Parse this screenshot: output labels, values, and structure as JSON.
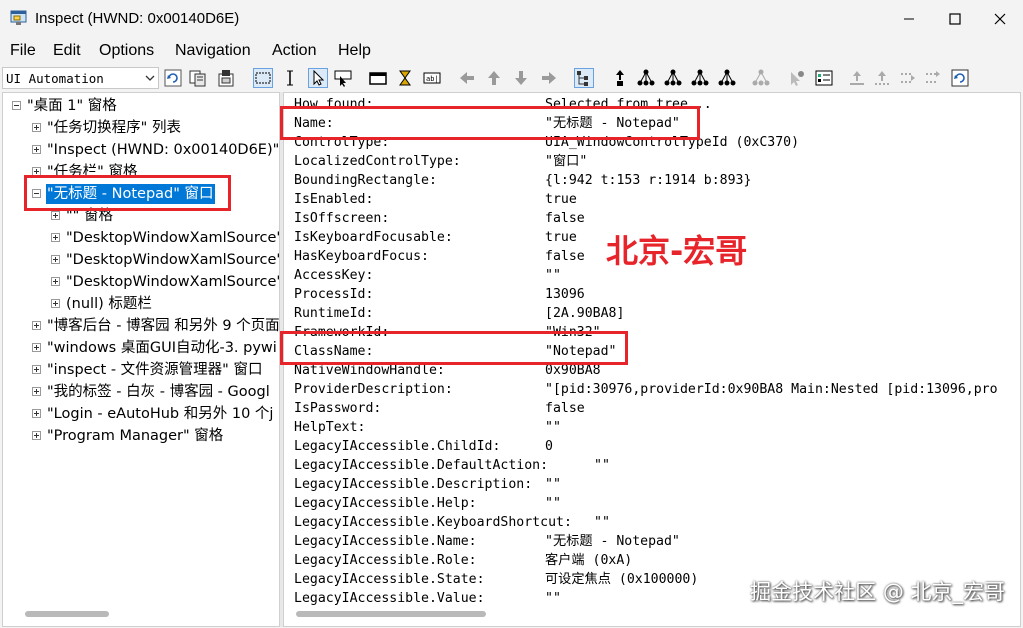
{
  "window": {
    "title": "Inspect  (HWND: 0x00140D6E)",
    "minimize_glyph": "—",
    "maximize_glyph": "☐",
    "close_glyph": "✕"
  },
  "menu": [
    "File",
    "Edit",
    "Options",
    "Navigation",
    "Action",
    "Help"
  ],
  "toolbar": {
    "mode_value": "UI Automation",
    "icons": [
      "refresh-icon",
      "copy-icon",
      "export-icon",
      "highlight-rect-icon",
      "text-cursor-icon",
      "pointer-icon",
      "watch-cursor-icon",
      "focus-icon",
      "hover-icon",
      "caret-icon",
      "nav-left-icon",
      "nav-up-icon",
      "nav-down-icon",
      "nav-right-icon",
      "tree-view-icon",
      "parent-icon",
      "first-child-icon",
      "next-sibling-icon",
      "prev-sibling-icon",
      "last-child-icon",
      "ancestor-icon",
      "do-default-icon",
      "options-icon",
      "move-icon",
      "expand-icon",
      "settings-icon"
    ]
  },
  "tree": [
    {
      "label": "\"桌面 1\" 窗格",
      "expander": "minus"
    },
    {
      "label": "\"任务切换程序\" 列表",
      "expander": "plus"
    },
    {
      "label": "\"Inspect  (HWND: 0x00140D6E)\"",
      "expander": "plus"
    },
    {
      "label": "\"任务栏\" 窗格",
      "expander": "plus"
    },
    {
      "label": "\"无标题 - Notepad\" 窗口",
      "expander": "minus",
      "selected": true
    },
    {
      "label": "\"\" 窗格",
      "expander": "plus"
    },
    {
      "label": "\"DesktopWindowXamlSource\"",
      "expander": "plus"
    },
    {
      "label": "\"DesktopWindowXamlSource\"",
      "expander": "plus"
    },
    {
      "label": "\"DesktopWindowXamlSource\"",
      "expander": "plus"
    },
    {
      "label": "(null) 标题栏",
      "expander": "plus"
    },
    {
      "label": "\"博客后台 - 博客园 和另外 9 个页面",
      "expander": "plus"
    },
    {
      "label": "\"windows 桌面GUI自动化-3. pywi",
      "expander": "plus"
    },
    {
      "label": "\"inspect - 文件资源管理器\" 窗口",
      "expander": "plus"
    },
    {
      "label": "\"我的标签 - 白灰 - 博客园 - Googl",
      "expander": "plus"
    },
    {
      "label": "\"Login - eAutoHub 和另外 10 个j",
      "expander": "plus"
    },
    {
      "label": "\"Program Manager\" 窗格",
      "expander": "plus"
    }
  ],
  "properties": [
    {
      "name": "How found:",
      "value": "Selected from tree..."
    },
    {
      "name": "Name:",
      "value": "\"无标题 - Notepad\""
    },
    {
      "name": "ControlType:",
      "value": "UIA_WindowControlTypeId (0xC370)"
    },
    {
      "name": "LocalizedControlType:",
      "value": "\"窗口\""
    },
    {
      "name": "BoundingRectangle:",
      "value": "{l:942 t:153 r:1914 b:893}"
    },
    {
      "name": "IsEnabled:",
      "value": "true"
    },
    {
      "name": "IsOffscreen:",
      "value": "false"
    },
    {
      "name": "IsKeyboardFocusable:",
      "value": "true"
    },
    {
      "name": "HasKeyboardFocus:",
      "value": "false"
    },
    {
      "name": "AccessKey:",
      "value": "\"\""
    },
    {
      "name": "ProcessId:",
      "value": "13096"
    },
    {
      "name": "RuntimeId:",
      "value": "[2A.90BA8]"
    },
    {
      "name": "FrameworkId:",
      "value": "\"Win32\""
    },
    {
      "name": "ClassName:",
      "value": "\"Notepad\""
    },
    {
      "name": "NativeWindowHandle:",
      "value": "0x90BA8"
    },
    {
      "name": "ProviderDescription:",
      "value": "\"[pid:30976,providerId:0x90BA8 Main:Nested [pid:13096,pro"
    },
    {
      "name": "IsPassword:",
      "value": "false"
    },
    {
      "name": "HelpText:",
      "value": "\"\""
    },
    {
      "name": "LegacyIAccessible.ChildId:",
      "value": "0"
    },
    {
      "name": "LegacyIAccessible.DefaultAction:",
      "value": "\"\""
    },
    {
      "name": "LegacyIAccessible.Description:",
      "value": "\"\""
    },
    {
      "name": "LegacyIAccessible.Help:",
      "value": "\"\""
    },
    {
      "name": "LegacyIAccessible.KeyboardShortcut:",
      "value": "\"\""
    },
    {
      "name": "LegacyIAccessible.Name:",
      "value": "\"无标题 - Notepad\""
    },
    {
      "name": "LegacyIAccessible.Role:",
      "value": "客户端 (0xA)"
    },
    {
      "name": "LegacyIAccessible.State:",
      "value": "可设定焦点 (0x100000)"
    },
    {
      "name": "LegacyIAccessible.Value:",
      "value": "\"\""
    }
  ],
  "annotation_text": "北京-宏哥",
  "watermark": "掘金技术社区 @ 北京_宏哥",
  "colors": {
    "highlight": "#e8242b",
    "selection": "#0078d7"
  }
}
